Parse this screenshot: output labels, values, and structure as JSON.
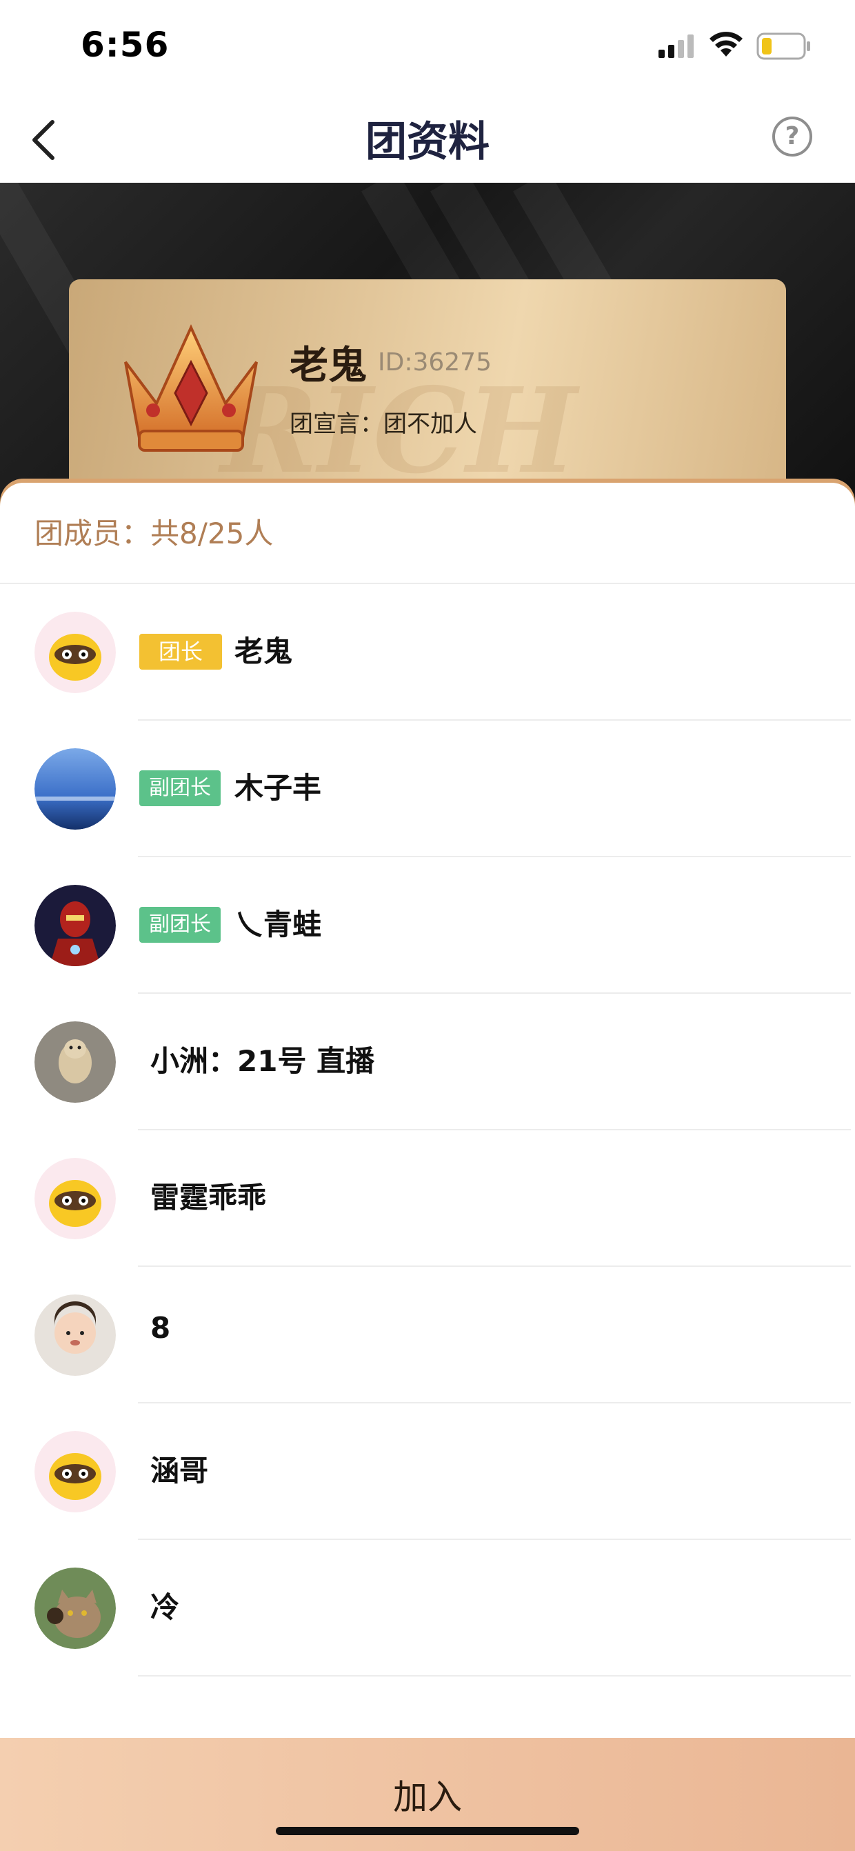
{
  "status_bar": {
    "time": "6:56"
  },
  "nav": {
    "title": "团资料",
    "help_glyph": "?"
  },
  "group_card": {
    "name": "老鬼",
    "id_text": "ID:36275",
    "motto": "团宣言：团不加人",
    "watermark": "RICH"
  },
  "members": {
    "header": "团成员：共8/25人",
    "items": [
      {
        "name": "老鬼",
        "role": "团长",
        "avatar": "raccoon-mascot"
      },
      {
        "name": "木子丰",
        "role": "副团长",
        "avatar": "sky-photo"
      },
      {
        "name": "乀青蛙",
        "role": "副团长",
        "avatar": "ironman-photo"
      },
      {
        "name": "小洲：21号 直播",
        "role": "",
        "avatar": "dog-photo"
      },
      {
        "name": "雷霆乖乖",
        "role": "",
        "avatar": "raccoon-mascot"
      },
      {
        "name": "8",
        "role": "",
        "avatar": "baby-photo"
      },
      {
        "name": "涵哥",
        "role": "",
        "avatar": "raccoon-mascot"
      },
      {
        "name": "冷",
        "role": "",
        "avatar": "cat-photo"
      }
    ]
  },
  "join_button": {
    "label": "加入"
  },
  "colors": {
    "leader_badge": "#f3c132",
    "deputy_badge": "#5cc28a",
    "header_text": "#b07e55",
    "join_gradient_start": "#f4cfb0",
    "join_gradient_end": "#eab694"
  }
}
